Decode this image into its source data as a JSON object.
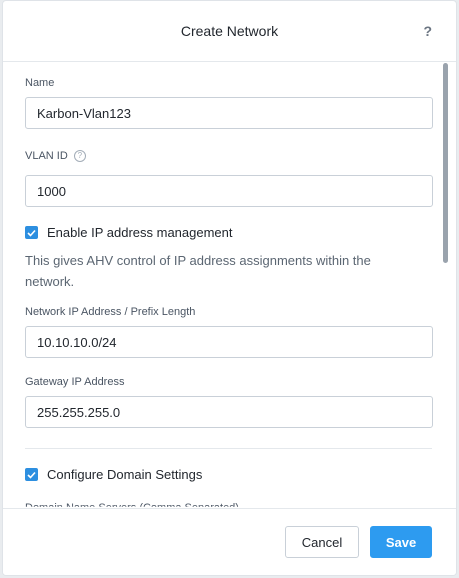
{
  "dialog": {
    "title": "Create Network",
    "help_label": "?"
  },
  "form": {
    "name_label": "Name",
    "name_value": "Karbon-Vlan123",
    "vlan_label": "VLAN ID",
    "vlan_info": "?",
    "vlan_value": "1000",
    "ipam_checkbox_label": "Enable IP address management",
    "ipam_checked": true,
    "ipam_description": "This gives AHV control of IP address assignments within the network.",
    "network_ip_label": "Network IP Address / Prefix Length",
    "network_ip_value": "10.10.10.0/24",
    "gateway_label": "Gateway IP Address",
    "gateway_value": "255.255.255.0",
    "domain_checkbox_label": "Configure Domain Settings",
    "domain_checked": true,
    "dns_label": "Domain Name Servers (Comma Separated)"
  },
  "footer": {
    "cancel_label": "Cancel",
    "save_label": "Save"
  },
  "colors": {
    "accent": "#2d9bf0",
    "checkbox": "#2d8fe0",
    "border": "#c9d0d8"
  }
}
